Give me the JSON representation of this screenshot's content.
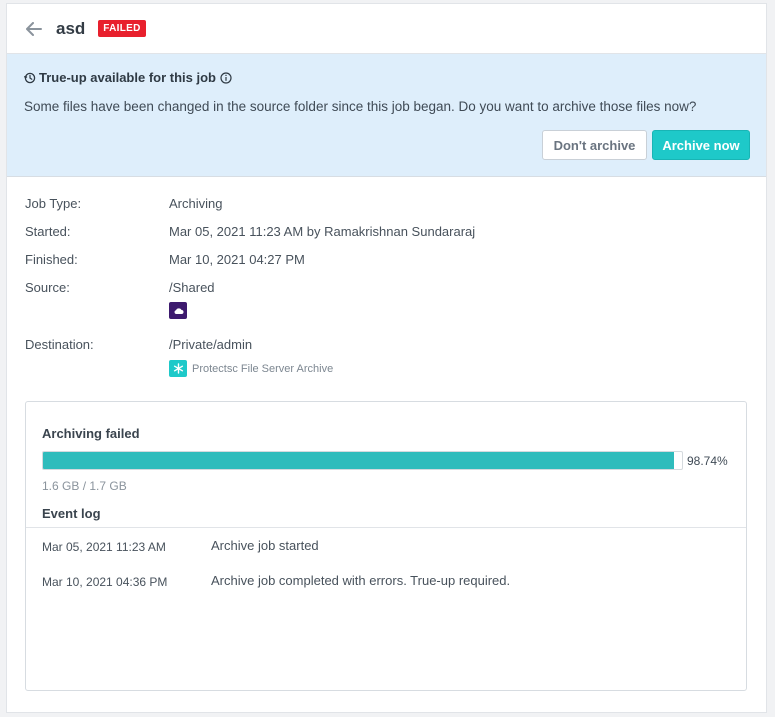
{
  "header": {
    "title": "asd",
    "status_badge": "FAILED"
  },
  "banner": {
    "title": "True-up available for this job",
    "message": "Some files have been changed in the source folder since this job began. Do you want to archive those files now?",
    "dont_archive_label": "Don't archive",
    "archive_now_label": "Archive now"
  },
  "details": {
    "job_type": {
      "label": "Job Type:",
      "value": "Archiving"
    },
    "started": {
      "label": "Started:",
      "value": "Mar 05, 2021 11:23 AM by Ramakrishnan Sundararaj"
    },
    "finished": {
      "label": "Finished:",
      "value": "Mar 10, 2021 04:27 PM"
    },
    "source": {
      "label": "Source:",
      "value": "/Shared",
      "icon": "cloud-storage-icon",
      "icon_color": "#3d1a6e"
    },
    "destination": {
      "label": "Destination:",
      "value": "/Private/admin",
      "storage_name": "Protectsc File Server Archive",
      "icon": "asterisk-storage-icon",
      "icon_color": "#1ec9c9"
    }
  },
  "progress": {
    "status_title": "Archiving failed",
    "percent": 98.74,
    "percent_label": "98.74%",
    "size_label": "1.6 GB / 1.7 GB",
    "fill_color": "#2fbcbc"
  },
  "event_log": {
    "title": "Event log",
    "events": [
      {
        "time": "Mar 05, 2021 11:23 AM",
        "message": "Archive job started"
      },
      {
        "time": "Mar 10, 2021 04:36 PM",
        "message": "Archive job completed with errors. True-up required."
      }
    ]
  },
  "colors": {
    "accent": "#1ec9c9",
    "danger": "#e8202d",
    "banner_bg": "#deeefb"
  }
}
